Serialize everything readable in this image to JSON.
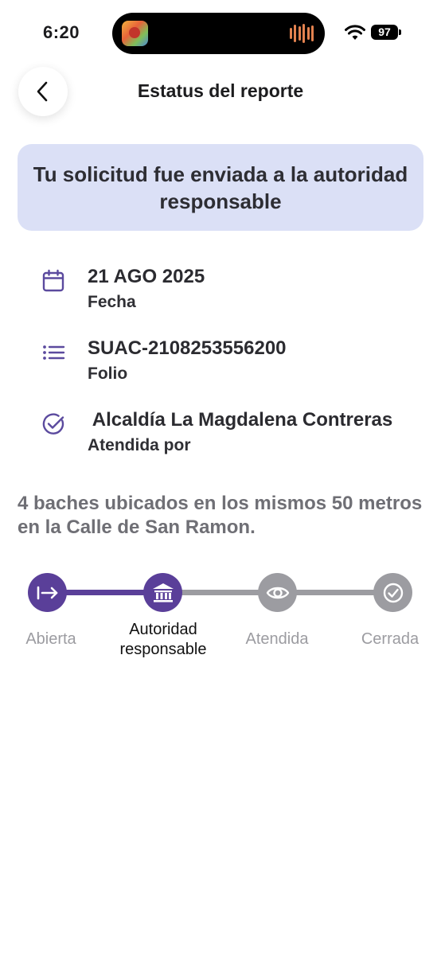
{
  "status_bar": {
    "time": "6:20",
    "battery": "97",
    "icons": [
      "now-playing-artwork-icon",
      "audio-waveform-icon",
      "wifi-icon",
      "battery-icon"
    ]
  },
  "header": {
    "title": "Estatus del reporte",
    "back_icon": "chevron-left-icon"
  },
  "banner": {
    "text": "Tu solicitud fue enviada a la autoridad responsable",
    "background": "#dbe0f6"
  },
  "details": [
    {
      "icon": "calendar-icon",
      "value": "21 AGO 2025",
      "label": "Fecha"
    },
    {
      "icon": "list-icon",
      "value": "SUAC-2108253556200",
      "label": "Folio"
    },
    {
      "icon": "check-circle-icon",
      "value": " Alcaldía La Magdalena Contreras",
      "label": "Atendida por"
    }
  ],
  "description": "4 baches ubicados en los mismos 50 metros en la Calle de San Ramon.",
  "progress": {
    "current_step": 2,
    "steps": [
      {
        "label": "Abierta",
        "icon": "arrow-to-right-icon",
        "state": "completed"
      },
      {
        "label": "Autoridad responsable",
        "icon": "bank-building-icon",
        "state": "current"
      },
      {
        "label": "Atendida",
        "icon": "eye-icon",
        "state": "pending"
      },
      {
        "label": "Cerrada",
        "icon": "check-circle-icon",
        "state": "pending"
      }
    ]
  },
  "colors": {
    "accent": "#5a3f99",
    "icon_purple": "#5b4a9e",
    "inactive": "#9c9ca1",
    "banner": "#dbe0f6",
    "muted_text": "#6f6f75"
  }
}
